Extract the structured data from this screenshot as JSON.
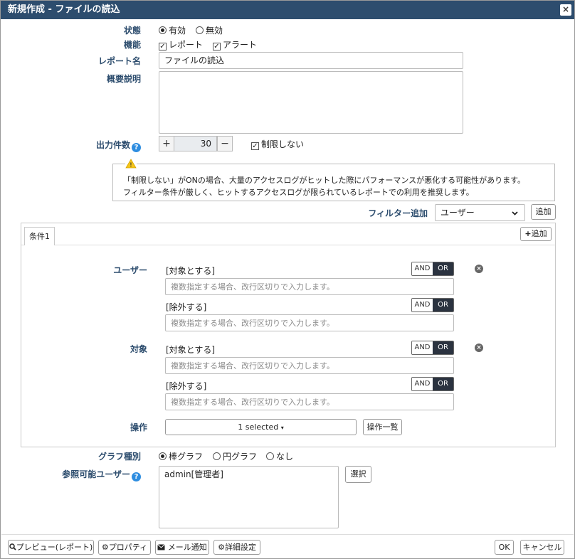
{
  "dialog": {
    "title": "新規作成 - ファイルの読込",
    "close": "×"
  },
  "labels": {
    "status": "状態",
    "feature": "機能",
    "report_name": "レポート名",
    "description": "概要説明",
    "output_count": "出力件数",
    "filter_add": "フィルター追加",
    "graph_type": "グラフ種別",
    "viewable_users": "参照可能ユーザー"
  },
  "status": {
    "enabled": "有効",
    "disabled": "無効"
  },
  "feature": {
    "report": "レポート",
    "alert": "アラート"
  },
  "report_name_value": "ファイルの読込",
  "output": {
    "value": "30",
    "plus": "+",
    "minus": "−",
    "unlimited": "制限しない"
  },
  "warning": {
    "line1": "「制限しない」がONの場合、大量のアクセスログがヒットした際にパフォーマンスが悪化する可能性があります。",
    "line2": "フィルター条件が厳しく、ヒットするアクセスログが限られているレポートでの利用を推奨します。"
  },
  "filter": {
    "selected": "ユーザー",
    "add_button": "追加"
  },
  "panel": {
    "tab": "条件1",
    "add_button": "追加",
    "user_label": "ユーザー",
    "target_label": "対象",
    "operation_label": "操作",
    "include": "[対象とする]",
    "exclude": "[除外する]",
    "placeholder": "複数指定する場合、改行区切りで入力します。",
    "and": "AND",
    "or": "OR",
    "operation_selected": "1 selected",
    "operation_list": "操作一覧"
  },
  "graph": {
    "bar": "棒グラフ",
    "pie": "円グラフ",
    "none": "なし"
  },
  "viewers": {
    "value": "admin[管理者]",
    "select_button": "選択"
  },
  "footer": {
    "preview": "プレビュー(レポート)",
    "property": "プロパティ",
    "mail": "メール通知",
    "advanced": "詳細設定",
    "ok": "OK",
    "cancel": "キャンセル"
  },
  "icons": {
    "warning": "warning-icon",
    "help": "question-icon",
    "remove": "x-circle-icon",
    "search": "search-icon",
    "gear": "gear-icon",
    "envelope": "envelope-icon",
    "gears": "gears-icon"
  },
  "colors": {
    "title_bar": "#2d4d6e",
    "label": "#2d4d6e",
    "help": "#2e8de0",
    "or_active": "#2b3340",
    "warning": "#f5c518"
  }
}
